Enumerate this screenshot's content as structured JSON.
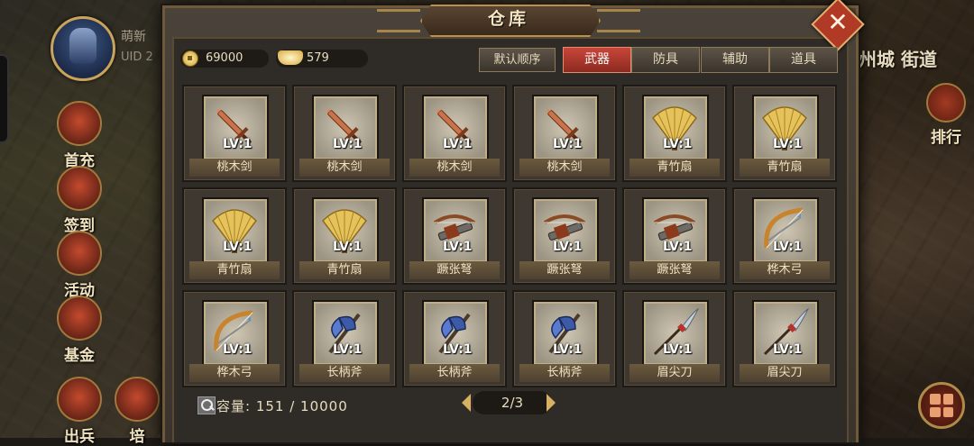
{
  "hud": {
    "player_name": "萌新",
    "uid_label": "UID 2",
    "city_label": "州城 街道",
    "side_buttons": [
      {
        "label": "首充",
        "icon": "first-recharge-icon"
      },
      {
        "label": "签到",
        "icon": "sign-in-icon"
      },
      {
        "label": "活动",
        "icon": "activity-icon"
      },
      {
        "label": "基金",
        "icon": "fund-icon"
      },
      {
        "label": "出兵",
        "icon": "deploy-icon"
      },
      {
        "label": "培",
        "icon": "train-icon"
      }
    ],
    "rank_label": "排行"
  },
  "window": {
    "title": "仓库",
    "close_glyph": "✕"
  },
  "currency": {
    "copper": "69000",
    "ingot": "579"
  },
  "sort_label": "默认顺序",
  "tabs": [
    {
      "label": "武器",
      "active": true
    },
    {
      "label": "防具",
      "active": false
    },
    {
      "label": "辅助",
      "active": false
    },
    {
      "label": "道具",
      "active": false
    }
  ],
  "items": [
    {
      "name": "桃木剑",
      "level": "LV:1",
      "icon": "sword"
    },
    {
      "name": "桃木剑",
      "level": "LV:1",
      "icon": "sword"
    },
    {
      "name": "桃木剑",
      "level": "LV:1",
      "icon": "sword"
    },
    {
      "name": "桃木剑",
      "level": "LV:1",
      "icon": "sword"
    },
    {
      "name": "青竹扇",
      "level": "LV:1",
      "icon": "fan"
    },
    {
      "name": "青竹扇",
      "level": "LV:1",
      "icon": "fan"
    },
    {
      "name": "青竹扇",
      "level": "LV:1",
      "icon": "fan"
    },
    {
      "name": "青竹扇",
      "level": "LV:1",
      "icon": "fan"
    },
    {
      "name": "蹶张弩",
      "level": "LV:1",
      "icon": "crossbow"
    },
    {
      "name": "蹶张弩",
      "level": "LV:1",
      "icon": "crossbow"
    },
    {
      "name": "蹶张弩",
      "level": "LV:1",
      "icon": "crossbow"
    },
    {
      "name": "桦木弓",
      "level": "LV:1",
      "icon": "bow"
    },
    {
      "name": "桦木弓",
      "level": "LV:1",
      "icon": "bow"
    },
    {
      "name": "长柄斧",
      "level": "LV:1",
      "icon": "axe"
    },
    {
      "name": "长柄斧",
      "level": "LV:1",
      "icon": "axe"
    },
    {
      "name": "长柄斧",
      "level": "LV:1",
      "icon": "axe"
    },
    {
      "name": "眉尖刀",
      "level": "LV:1",
      "icon": "glaive"
    },
    {
      "name": "眉尖刀",
      "level": "LV:1",
      "icon": "glaive"
    }
  ],
  "footer": {
    "capacity": "容量: 151 / 10000",
    "page": "2/3"
  }
}
